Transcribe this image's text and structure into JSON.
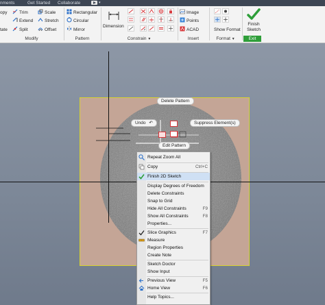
{
  "title_bar": {
    "tabs": [
      "nments",
      "Get Started",
      "Collaborate"
    ],
    "video_icon": "video-camera-icon"
  },
  "ribbon": {
    "modify": {
      "label": "Modify",
      "items": [
        {
          "label": "opy",
          "icon": "copy-icon"
        },
        {
          "label": "tate",
          "icon": "rotate-icon"
        },
        {
          "label": "Trim",
          "icon": "trim-icon"
        },
        {
          "label": "Extend",
          "icon": "extend-icon"
        },
        {
          "label": "Split",
          "icon": "split-icon"
        },
        {
          "label": "Scale",
          "icon": "scale-icon"
        },
        {
          "label": "Stretch",
          "icon": "stretch-icon"
        },
        {
          "label": "Offset",
          "icon": "offset-icon"
        }
      ]
    },
    "pattern": {
      "label": "Pattern",
      "items": [
        {
          "label": "Rectangular",
          "icon": "rectangular-pattern-icon"
        },
        {
          "label": "Circular",
          "icon": "circular-pattern-icon"
        },
        {
          "label": "Mirror",
          "icon": "mirror-icon"
        }
      ]
    },
    "constrain": {
      "label": "Constrain",
      "dimension_label": "Dimension",
      "dropdown_glyph": "▼"
    },
    "insert": {
      "label": "Insert",
      "items": [
        {
          "label": "Image",
          "icon": "image-icon"
        },
        {
          "label": "Points",
          "icon": "points-icon"
        },
        {
          "label": "ACAD",
          "icon": "acad-icon"
        }
      ]
    },
    "format": {
      "label": "Format",
      "dropdown_glyph": "▼",
      "show_format_label": "Show Format"
    },
    "exit": {
      "label": "Exit",
      "finish_line1": "Finish",
      "finish_line2": "Sketch"
    }
  },
  "canvas": {
    "pills": {
      "delete_pattern": "Delete Pattern",
      "undo": "Undo",
      "suppress": "Suppress Element(s)",
      "edit_pattern": "Edit Pattern"
    }
  },
  "context_menu": {
    "items": [
      {
        "label": "Repeat Zoom All",
        "shortcut": "",
        "icon": "zoom-icon"
      },
      {
        "label": "Copy",
        "shortcut": "Ctrl+C",
        "icon": "copy-icon"
      },
      {
        "label": "Finish 2D Sketch",
        "shortcut": "",
        "icon": "checkmark-icon"
      },
      {
        "label": "Display Degrees of Freedom",
        "shortcut": "",
        "icon": ""
      },
      {
        "label": "Delete Constraints",
        "shortcut": "",
        "icon": ""
      },
      {
        "label": "Snap to Grid",
        "shortcut": "",
        "icon": ""
      },
      {
        "label": "Hide All Constraints",
        "shortcut": "F9",
        "icon": ""
      },
      {
        "label": "Show All Constraints",
        "shortcut": "F8",
        "icon": ""
      },
      {
        "label": "Properties...",
        "shortcut": "",
        "icon": ""
      },
      {
        "label": "Slice Graphics",
        "shortcut": "F7",
        "icon": "checkmark-icon"
      },
      {
        "label": "Measure",
        "shortcut": "",
        "icon": "measure-icon"
      },
      {
        "label": "Region Properties",
        "shortcut": "",
        "icon": ""
      },
      {
        "label": "Create Note",
        "shortcut": "",
        "icon": ""
      },
      {
        "label": "Sketch Doctor",
        "shortcut": "",
        "icon": ""
      },
      {
        "label": "Show Input",
        "shortcut": "",
        "icon": ""
      },
      {
        "label": "Previous View",
        "shortcut": "F5",
        "icon": "previous-view-icon"
      },
      {
        "label": "Home View",
        "shortcut": "F6",
        "icon": "home-icon"
      },
      {
        "label": "Help Topics...",
        "shortcut": "",
        "icon": ""
      }
    ]
  },
  "colors": {
    "titlebar": "#3d4654",
    "ribbon": "#f3f3f3",
    "accent_green": "#2e9e39",
    "menu_highlight": "#cfe0f4",
    "plate": "#c4a596",
    "plate_border": "#d8d330",
    "disk": "#7c7c7c",
    "sketch_red": "#d8363a"
  }
}
